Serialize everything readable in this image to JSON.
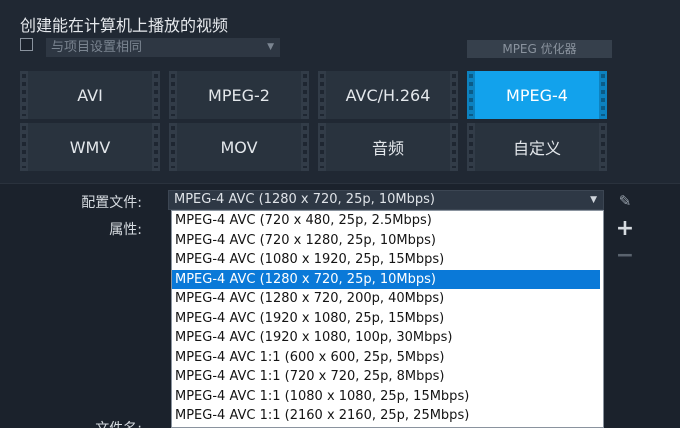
{
  "dialog": {
    "title": "创建能在计算机上播放的视频",
    "match_project": {
      "checked": false,
      "select_value": "与项目设置相同"
    },
    "optimizer_label": "MPEG 优化器"
  },
  "formats": [
    {
      "label": "AVI",
      "selected": false
    },
    {
      "label": "MPEG-2",
      "selected": false
    },
    {
      "label": "AVC/H.264",
      "selected": false
    },
    {
      "label": "MPEG-4",
      "selected": true
    },
    {
      "label": "WMV",
      "selected": false
    },
    {
      "label": "MOV",
      "selected": false
    },
    {
      "label": "音频",
      "selected": false
    },
    {
      "label": "自定义",
      "selected": false
    }
  ],
  "settings": {
    "profile_label": "配置文件:",
    "profile_value": "MPEG-4 AVC (1280 x 720, 25p, 10Mbps)",
    "properties_label": "属性:",
    "filename_label": "文件名:"
  },
  "profile_options": [
    "MPEG-4 AVC (720 x 480, 25p, 2.5Mbps)",
    "MPEG-4 AVC (720 x 1280, 25p, 10Mbps)",
    "MPEG-4 AVC (1080 x 1920, 25p, 15Mbps)",
    "MPEG-4 AVC (1280 x 720, 25p, 10Mbps)",
    "MPEG-4 AVC (1280 x 720, 200p, 40Mbps)",
    "MPEG-4 AVC (1920 x 1080, 25p, 15Mbps)",
    "MPEG-4 AVC (1920 x 1080, 100p, 30Mbps)",
    "MPEG-4 AVC 1:1 (600 x 600, 25p, 5Mbps)",
    "MPEG-4 AVC 1:1 (720 x 720, 25p, 8Mbps)",
    "MPEG-4 AVC 1:1 (1080 x 1080, 25p, 15Mbps)",
    "MPEG-4 AVC 1:1 (2160 x 2160, 25p, 25Mbps)"
  ],
  "highlighted_option": 3,
  "icons": {
    "edit": "pencil-icon",
    "add": "plus-icon",
    "remove": "minus-icon"
  },
  "colors": {
    "accent": "#12a2ec",
    "highlight": "#0a79d8",
    "background": "#1e2631"
  }
}
